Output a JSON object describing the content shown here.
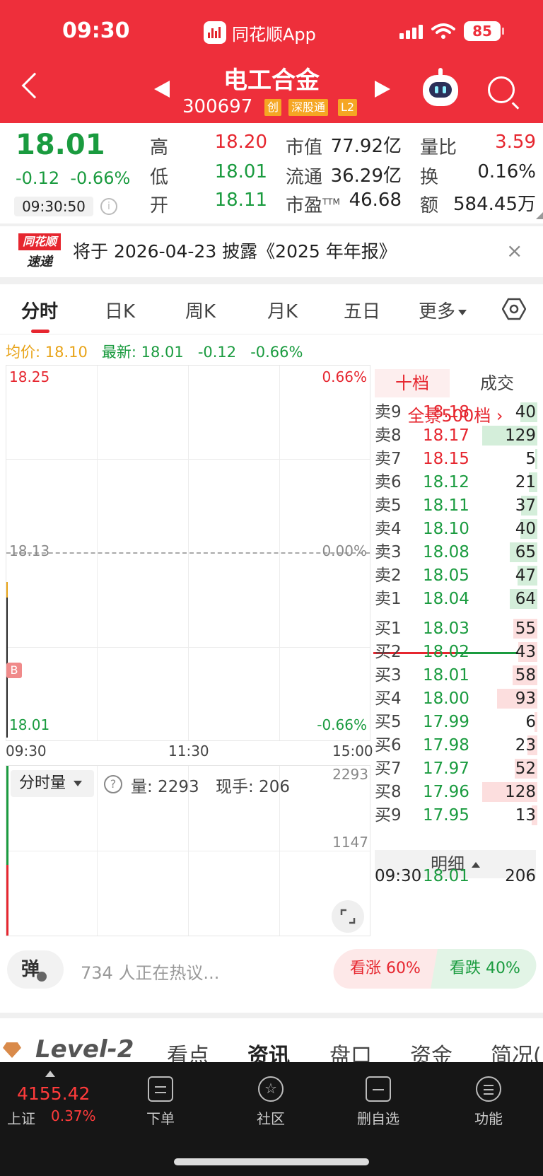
{
  "status_bar": {
    "time": "09:30",
    "app_name": "同花顺App",
    "battery": "85"
  },
  "header": {
    "stock_name": "电工合金",
    "stock_code": "300697",
    "tags": [
      "创",
      "深股通",
      "L2"
    ],
    "colors": {
      "bg": "#ee2f3b"
    }
  },
  "quote": {
    "price": "18.01",
    "change": "-0.12",
    "change_pct": "-0.66%",
    "time": "09:30:50",
    "high_label": "高",
    "high": "18.20",
    "low_label": "低",
    "low": "18.01",
    "open_label": "开",
    "open": "18.11",
    "mcap_label": "市值",
    "mcap": "77.92亿",
    "float_label": "流通",
    "float": "36.29亿",
    "pe_label": "市盈",
    "pe_sup": "TTM",
    "pe": "46.68",
    "vr_label": "量比",
    "vr": "3.59",
    "turnover_label": "换",
    "turnover": "0.16%",
    "amount_label": "额",
    "amount": "584.45万"
  },
  "banner": {
    "logo_top": "同花顺",
    "logo_bottom": "速递",
    "text": "将于 2026-04-23 披露《2025 年年报》",
    "close": "×"
  },
  "tabs": [
    "分时",
    "日K",
    "周K",
    "月K",
    "五日",
    "更多"
  ],
  "avg_line": {
    "avg_label": "均价: 18.10",
    "latest_label": "最新: 18.01",
    "change": "-0.12",
    "change_pct": "-0.66%"
  },
  "chart": {
    "y_top": "18.25",
    "y_mid": "18.13",
    "y_bot": "18.01",
    "pct_top": "0.66%",
    "pct_mid": "0.00%",
    "pct_bot": "-0.66%",
    "t_start": "09:30",
    "t_mid": "11:30",
    "t_end": "15:00",
    "b_badge": "B"
  },
  "volume": {
    "selector": "分时量",
    "vol_label": "量: 2293",
    "hand_label": "现手: 206",
    "y_top": "2293",
    "y_mid": "1147"
  },
  "book": {
    "tab_active": "十档",
    "tab_other": "成交",
    "full_depth": "全景500档",
    "asks": [
      {
        "label": "卖9",
        "price": "18.18",
        "vol": "40",
        "level": 0.31
      },
      {
        "label": "卖8",
        "price": "18.17",
        "vol": "129",
        "level": 1.0
      },
      {
        "label": "卖7",
        "price": "18.15",
        "vol": "5",
        "level": 0.04
      },
      {
        "label": "卖6",
        "price": "18.12",
        "vol": "21",
        "level": 0.16
      },
      {
        "label": "卖5",
        "price": "18.11",
        "vol": "37",
        "level": 0.29
      },
      {
        "label": "卖4",
        "price": "18.10",
        "vol": "40",
        "level": 0.31
      },
      {
        "label": "卖3",
        "price": "18.08",
        "vol": "65",
        "level": 0.5
      },
      {
        "label": "卖2",
        "price": "18.05",
        "vol": "47",
        "level": 0.36
      },
      {
        "label": "卖1",
        "price": "18.04",
        "vol": "64",
        "level": 0.5
      }
    ],
    "bids": [
      {
        "label": "买1",
        "price": "18.03",
        "vol": "55",
        "level": 0.43
      },
      {
        "label": "买2",
        "price": "18.02",
        "vol": "43",
        "level": 0.34
      },
      {
        "label": "买3",
        "price": "18.01",
        "vol": "58",
        "level": 0.45
      },
      {
        "label": "买4",
        "price": "18.00",
        "vol": "93",
        "level": 0.73
      },
      {
        "label": "买5",
        "price": "17.99",
        "vol": "6",
        "level": 0.05
      },
      {
        "label": "买6",
        "price": "17.98",
        "vol": "23",
        "level": 0.18
      },
      {
        "label": "买7",
        "price": "17.97",
        "vol": "52",
        "level": 0.41
      },
      {
        "label": "买8",
        "price": "17.96",
        "vol": "128",
        "level": 1.0
      },
      {
        "label": "买9",
        "price": "17.95",
        "vol": "13",
        "level": 0.1
      }
    ],
    "detail_label": "明细",
    "detail_time": "09:30",
    "detail_price": "18.01",
    "detail_vol": "206"
  },
  "comment": {
    "danmu": "弹",
    "hot": "734 人正在热议...",
    "up": "看涨 60%",
    "down": "看跌 40%"
  },
  "lower_tabs": [
    "Level-2",
    "看点",
    "资讯",
    "盘口",
    "资金",
    "简况("
  ],
  "bottom_nav": {
    "index_value": "4155.42",
    "index_name": "上证",
    "index_pct": "0.37%",
    "items": [
      "下单",
      "社区",
      "删自选",
      "功能"
    ]
  }
}
